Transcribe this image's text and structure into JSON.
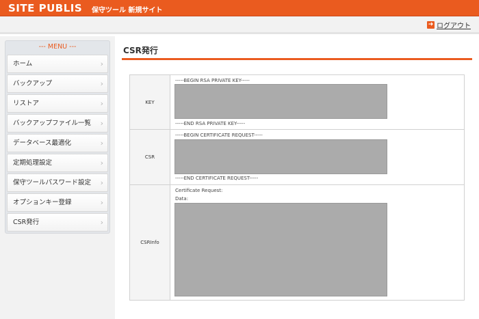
{
  "header": {
    "logo": "SITE PUBLIS",
    "subtitle": "保守ツール 新規サイト"
  },
  "topbar": {
    "logout_label": "ログアウト",
    "logout_icon": "logout-icon"
  },
  "sidebar": {
    "menu_title": "--- MENU ---",
    "items": [
      {
        "label": "ホーム"
      },
      {
        "label": "バックアップ"
      },
      {
        "label": "リストア"
      },
      {
        "label": "バックアップファイル一覧"
      },
      {
        "label": "データベース最適化"
      },
      {
        "label": "定期処理設定"
      },
      {
        "label": "保守ツールパスワード設定"
      },
      {
        "label": "オプションキー登録"
      },
      {
        "label": "CSR発行"
      }
    ]
  },
  "main": {
    "title": "CSR発行",
    "rows": {
      "key": {
        "label": "KEY",
        "begin": "-----BEGIN RSA PRIVATE KEY-----",
        "end": "-----END RSA PRIVATE KEY-----",
        "value": ""
      },
      "csr": {
        "label": "CSR",
        "begin": "-----BEGIN CERTIFICATE REQUEST-----",
        "end": "-----END CERTIFICATE REQUEST-----",
        "value": ""
      },
      "csrinfo": {
        "label": "CSRInfo",
        "line1": "Certificate Request:",
        "line2": "Data:",
        "value": ""
      }
    }
  },
  "colors": {
    "accent": "#ea5b1f",
    "textarea": "#ababab"
  }
}
